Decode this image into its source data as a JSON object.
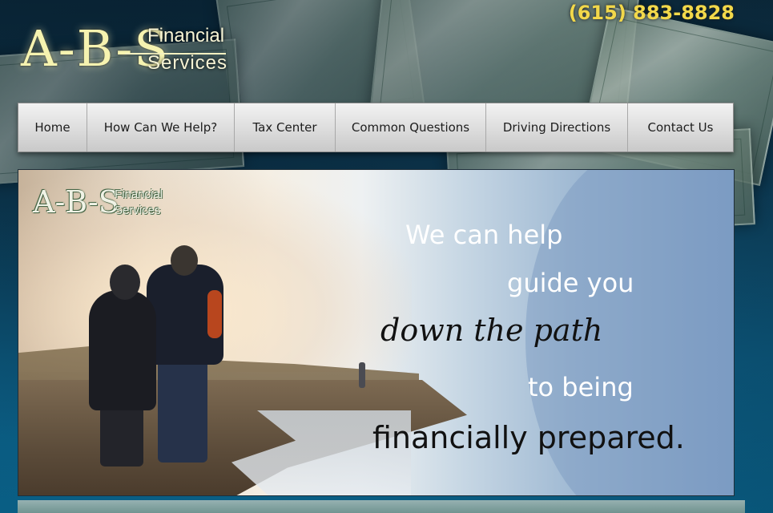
{
  "header": {
    "logo": {
      "abs": "A-B-S",
      "word1": "Financial",
      "word2": "Services"
    },
    "phone": "(615) 883-8828"
  },
  "nav": {
    "items": [
      {
        "label": "Home"
      },
      {
        "label": "How Can We Help?"
      },
      {
        "label": "Tax Center"
      },
      {
        "label": "Common Questions"
      },
      {
        "label": "Driving Directions"
      },
      {
        "label": "Contact Us"
      }
    ]
  },
  "banner": {
    "logo": {
      "abs": "A-B-S",
      "word1": "Financial",
      "word2": "Services"
    },
    "tagline": {
      "line1": "We can help",
      "line2": "guide you",
      "line3": "down the path",
      "line4": "to being",
      "line5": "financially prepared."
    }
  },
  "colors": {
    "phone": "#f2d84a",
    "logo": "#f6f3b0",
    "nav_text": "#1d1d1d"
  }
}
